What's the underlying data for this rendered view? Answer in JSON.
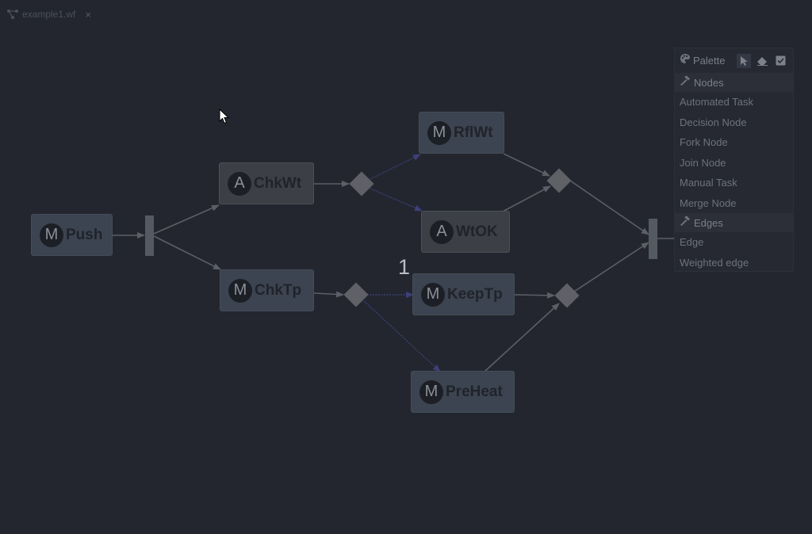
{
  "tab": {
    "label": "example1.wf",
    "close": "×",
    "icon": "workflow-icon"
  },
  "nodes": [
    {
      "id": "push",
      "type": "manual",
      "badge": "M",
      "label": "Push"
    },
    {
      "id": "chkwt",
      "type": "automated",
      "badge": "A",
      "label": "ChkWt"
    },
    {
      "id": "chktp",
      "type": "manual",
      "badge": "M",
      "label": "ChkTp"
    },
    {
      "id": "rflwt",
      "type": "manual",
      "badge": "M",
      "label": "RflWt"
    },
    {
      "id": "wtok",
      "type": "automated",
      "badge": "A",
      "label": "WtOK"
    },
    {
      "id": "keeptp",
      "type": "manual",
      "badge": "M",
      "label": "KeepTp"
    },
    {
      "id": "preheat",
      "type": "manual",
      "badge": "M",
      "label": "PreHeat"
    }
  ],
  "edge_count_label": "1",
  "palette": {
    "title": "Palette",
    "icon": "palette-icon",
    "tools": [
      "pointer-tool-icon",
      "eraser-tool-icon",
      "validate-tool-icon"
    ],
    "groups": [
      {
        "label": "Nodes",
        "icon": "hammer-icon",
        "items": [
          "Automated Task",
          "Decision Node",
          "Fork Node",
          "Join Node",
          "Manual Task",
          "Merge Node"
        ]
      },
      {
        "label": "Edges",
        "icon": "hammer-icon",
        "items": [
          "Edge",
          "Weighted edge"
        ]
      }
    ]
  },
  "colors": {
    "background": "#23262e",
    "manual_node": "#3b4450",
    "automated_node": "#3c3f45",
    "edge": "#5c5f66",
    "weighted_edge": "#3d3f78",
    "decision": "#5f6167"
  }
}
